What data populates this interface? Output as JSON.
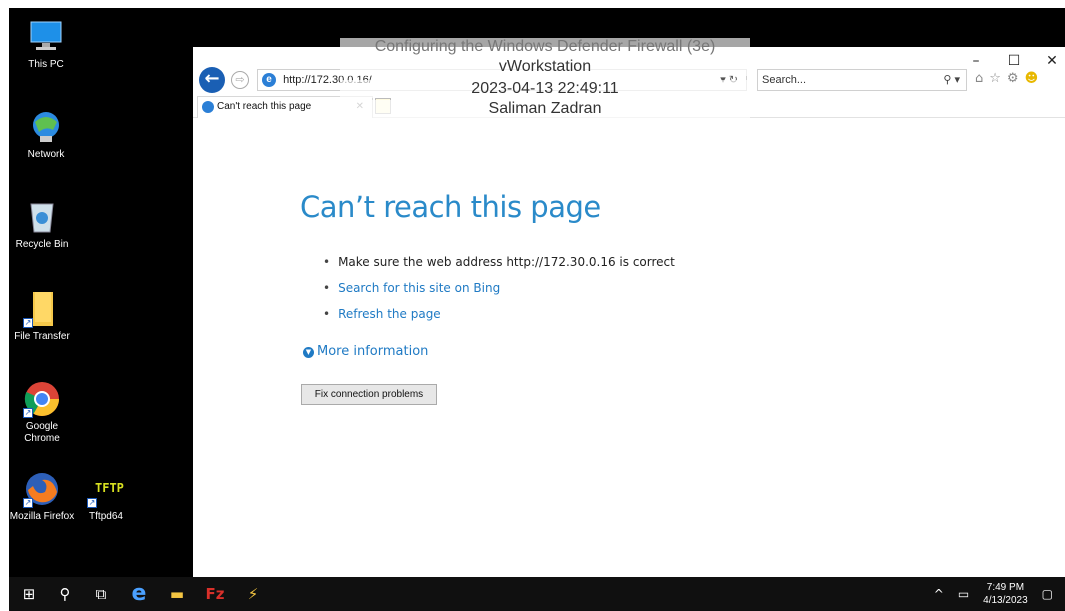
{
  "desktop": {
    "icons": [
      {
        "label": "This PC",
        "icon": "computer-icon"
      },
      {
        "label": "Network",
        "icon": "network-icon"
      },
      {
        "label": "Recycle Bin",
        "icon": "recycle-bin-icon"
      },
      {
        "label": "File Transfer",
        "icon": "folder-icon"
      },
      {
        "label": "Google Chrome",
        "icon": "chrome-icon"
      },
      {
        "label": "Mozilla Firefox",
        "icon": "firefox-icon"
      },
      {
        "label": "Tftpd64",
        "icon": "tftpd-icon"
      }
    ]
  },
  "overlay": {
    "line1": "Configuring the Windows Defender Firewall (3e)",
    "line2": "vWorkstation",
    "line3": "2023-04-13 22:49:11",
    "line4": "Saliman Zadran"
  },
  "browser": {
    "address": "http://172.30.0.16/",
    "search_placeholder": "Search...",
    "tab_title": "Can't reach this page",
    "controls": {
      "minimize": "–",
      "maximize": "☐",
      "close": "✕"
    }
  },
  "page": {
    "title": "Can’t reach this page",
    "bullet1": "Make sure the web address http://172.30.0.16 is correct",
    "bullet2": "Search for this site on Bing",
    "bullet3": "Refresh the page",
    "more_info": "More information",
    "fix_button": "Fix connection problems"
  },
  "taskbar": {
    "time": "7:49 PM",
    "date": "4/13/2023"
  },
  "colors": {
    "accent": "#2a8ac9",
    "link": "#1f7ac4",
    "ie_blue": "#1a5fb4"
  }
}
